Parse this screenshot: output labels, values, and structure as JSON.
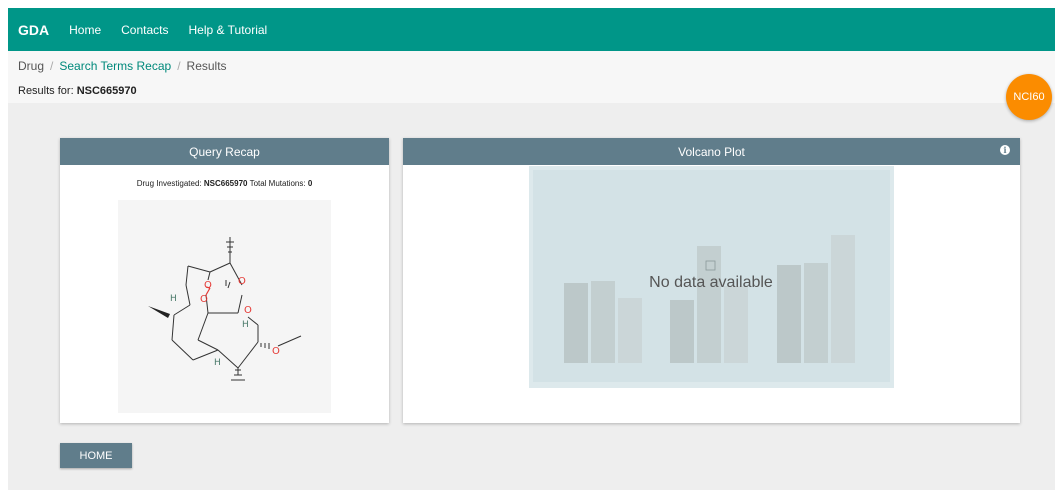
{
  "navbar": {
    "brand": "GDA",
    "links": [
      "Home",
      "Contacts",
      "Help & Tutorial"
    ]
  },
  "breadcrumb": [
    "Drug",
    "Search Terms Recap",
    "Results"
  ],
  "results": {
    "label": "Results for:",
    "value": "NSC665970"
  },
  "badge": "NCI60",
  "query_recap": {
    "title": "Query Recap",
    "drug_label": "Drug Investigated:",
    "drug_value": "NSC665970",
    "mutations_label": "Total Mutations:",
    "mutations_value": "0",
    "atom_labels": {
      "oxygen": "O",
      "hydrogen": "H"
    }
  },
  "volcano": {
    "title": "Volcano Plot",
    "info_icon": "info-icon",
    "empty_message": "No data available"
  },
  "home_button": "HOME",
  "colors": {
    "navbar": "#009688",
    "card_header": "#607d8b",
    "badge": "#fb8c00",
    "link": "#00897b",
    "oxygen": "#e53935",
    "hydrogen": "#4a7a6a"
  }
}
